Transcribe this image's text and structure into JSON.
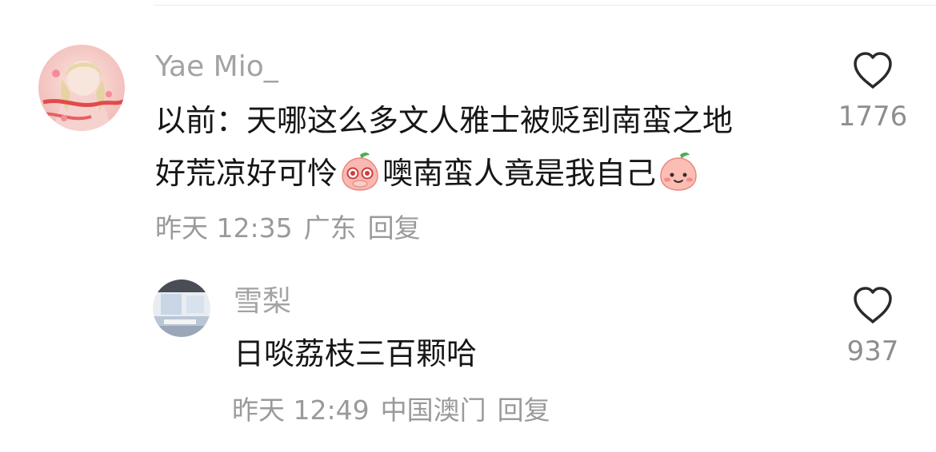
{
  "comment": {
    "username": "Yae Mio_",
    "line1": "以前：天哪这么多文人雅士被贬到南蛮之地",
    "line2_part1": "好荒凉好可怜",
    "line2_part2": "噢南蛮人竟是我自己",
    "time": "昨天 12:35",
    "location": "广东",
    "reply_label": "回复",
    "like_count": "1776",
    "avatar_icon": "anime-girl-avatar",
    "emojis": [
      "crying-peach-emoji",
      "smiling-peach-emoji"
    ]
  },
  "reply": {
    "username": "雪梨",
    "text": "日啖荔枝三百颗哈",
    "time": "昨天 12:49",
    "location": "中国澳门",
    "reply_label": "回复",
    "like_count": "937",
    "avatar_icon": "room-photo-avatar"
  },
  "colors": {
    "username": "#a3a3a3",
    "text": "#161616",
    "meta": "#9a9a9a",
    "heart_outline": "#2a2a2a"
  }
}
